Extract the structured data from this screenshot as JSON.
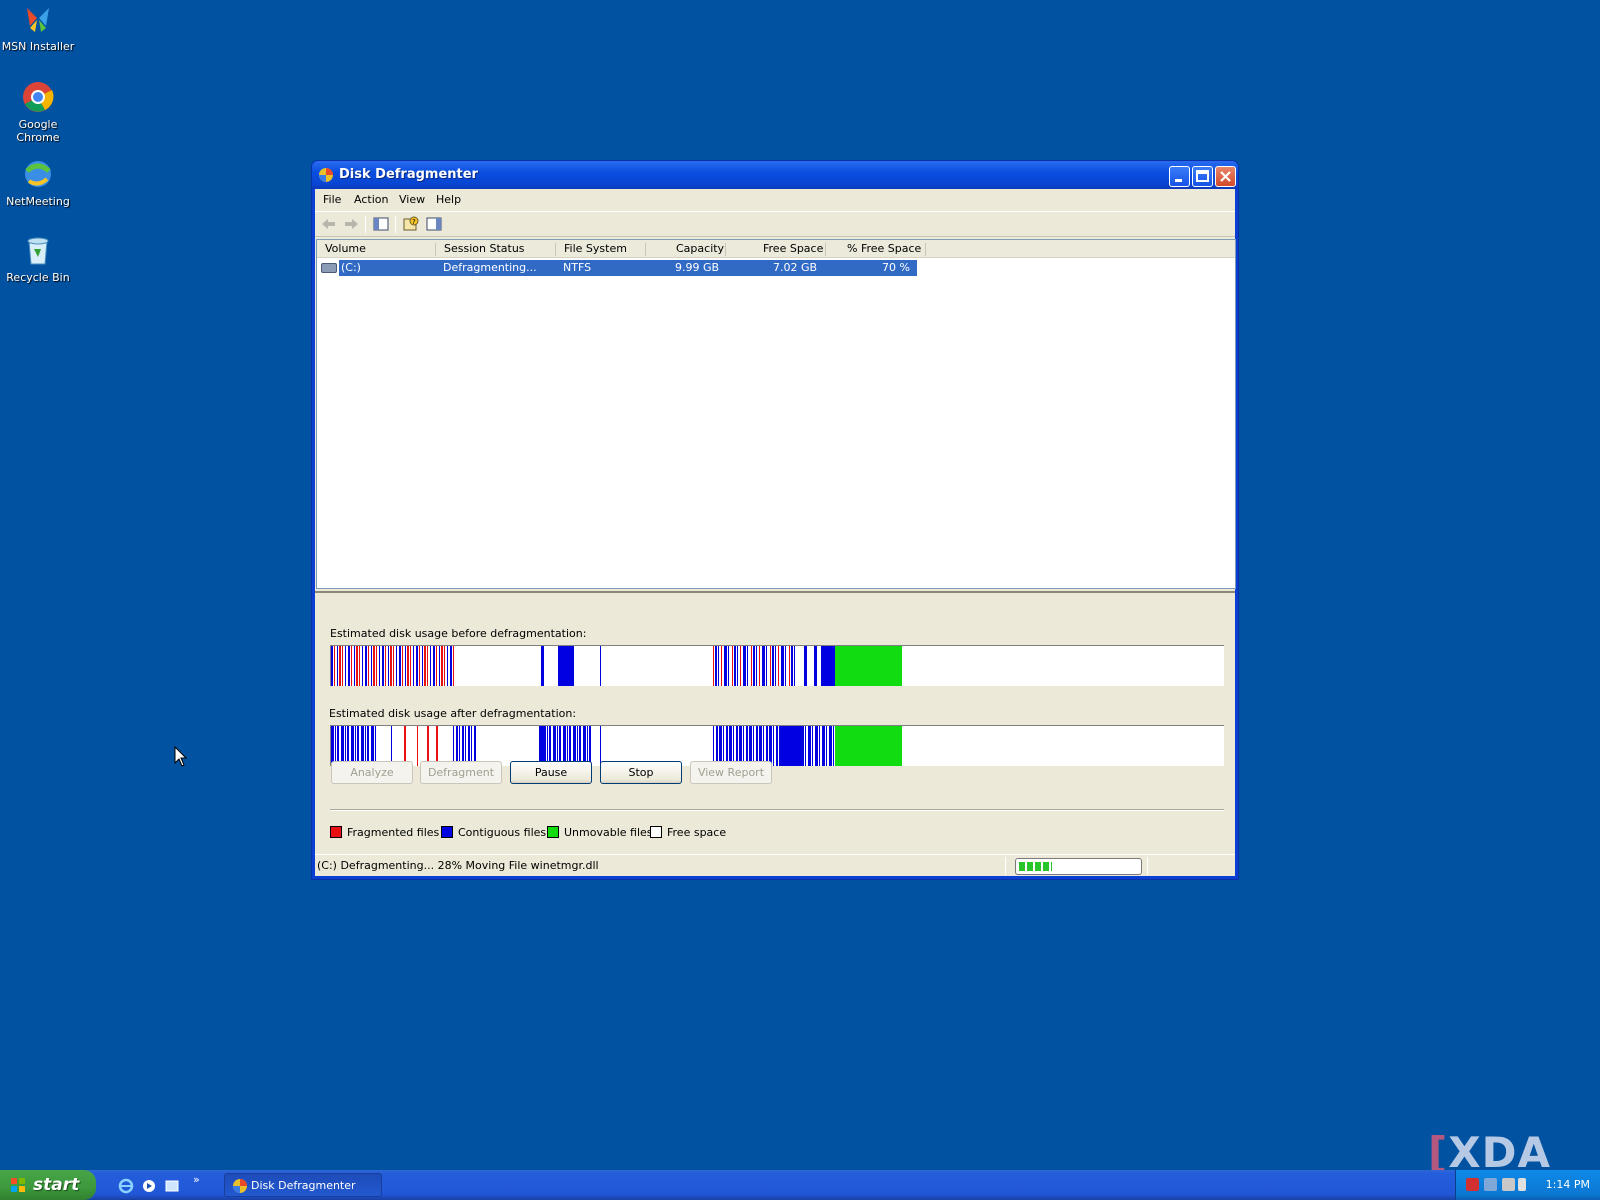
{
  "desktop": {
    "icons": [
      {
        "label": "MSN Installer"
      },
      {
        "label": "Google Chrome"
      },
      {
        "label": "NetMeeting"
      },
      {
        "label": "Recycle Bin"
      }
    ]
  },
  "window": {
    "title": "Disk Defragmenter",
    "menu": [
      "File",
      "Action",
      "View",
      "Help"
    ],
    "columns": [
      "Volume",
      "Session Status",
      "File System",
      "Capacity",
      "Free Space",
      "% Free Space"
    ],
    "rows": [
      {
        "volume": "(C:)",
        "status": "Defragmenting...",
        "fs": "NTFS",
        "capacity": "9.99 GB",
        "free": "7.02 GB",
        "pct_free": "70 %"
      }
    ],
    "before_label": "Estimated disk usage before defragmentation:",
    "after_label": "Estimated disk usage after defragmentation:",
    "buttons": {
      "analyze": "Analyze",
      "defragment": "Defragment",
      "pause": "Pause",
      "stop": "Stop",
      "view_report": "View Report"
    },
    "legend": {
      "fragmented": "Fragmented files",
      "contiguous": "Contiguous files",
      "unmovable": "Unmovable files",
      "free": "Free space"
    },
    "colors": {
      "fragmented": "#e81010",
      "contiguous": "#0000e0",
      "unmovable": "#10dc10",
      "free": "#ffffff"
    },
    "status_text": "(C:) Defragmenting... 28%  Moving File winetmgr.dll",
    "progress_fraction": 0.28
  },
  "taskbar": {
    "start_label": "start",
    "task_label": "Disk Defragmenter",
    "clock": "1:14 PM"
  },
  "watermark": "XDA"
}
